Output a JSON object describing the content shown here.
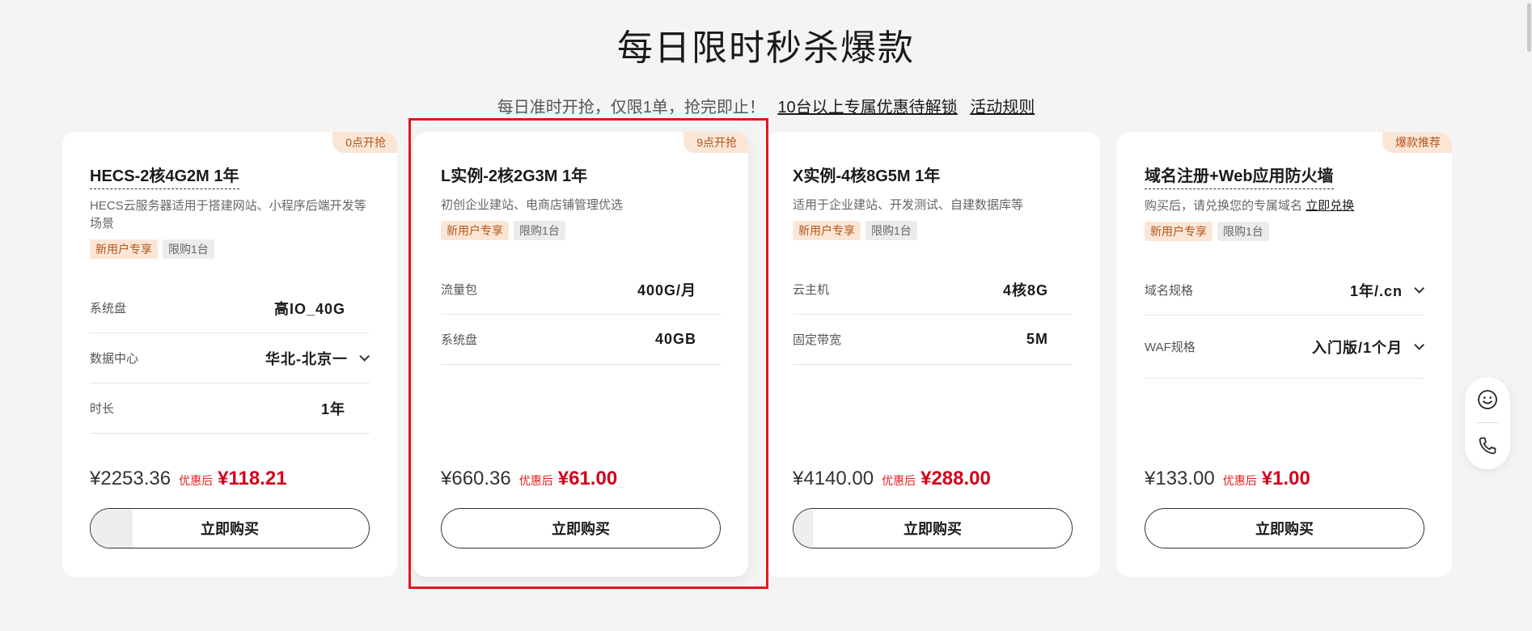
{
  "header": {
    "title": "每日限时秒杀爆款",
    "subtitle": "每日准时开抢，仅限1单，抢完即止！",
    "link_discount": "10台以上专属优惠待解锁",
    "link_rules": "活动规则"
  },
  "cards": [
    {
      "badge": "0点开抢",
      "title": "HECS-2核4G2M 1年",
      "desc": "HECS云服务器适用于搭建网站、小程序后端开发等场景",
      "tag_new": "新用户专享",
      "tag_limit": "限购1台",
      "specs": [
        {
          "label": "系统盘",
          "value": "高IO_40G"
        },
        {
          "label": "数据中心",
          "value": "华北-北京一"
        },
        {
          "label": "时长",
          "value": "1年"
        }
      ],
      "price_orig": "¥2253.36",
      "price_label": "优惠后",
      "price_final": "¥118.21",
      "buy_label": "立即购买",
      "buy_progress": 0.15
    },
    {
      "badge": "9点开抢",
      "title": "L实例-2核2G3M 1年",
      "desc": "初创企业建站、电商店铺管理优选",
      "tag_new": "新用户专享",
      "tag_limit": "限购1台",
      "specs": [
        {
          "label": "流量包",
          "value": "400G/月"
        },
        {
          "label": "系统盘",
          "value": "40GB"
        }
      ],
      "price_orig": "¥660.36",
      "price_label": "优惠后",
      "price_final": "¥61.00",
      "buy_label": "立即购买",
      "buy_progress": 0
    },
    {
      "title": "X实例-4核8G5M 1年",
      "desc": "适用于企业建站、开发测试、自建数据库等",
      "tag_new": "新用户专享",
      "tag_limit": "限购1台",
      "specs": [
        {
          "label": "云主机",
          "value": "4核8G"
        },
        {
          "label": "固定带宽",
          "value": "5M"
        }
      ],
      "price_orig": "¥4140.00",
      "price_label": "优惠后",
      "price_final": "¥288.00",
      "buy_label": "立即购买",
      "buy_progress": 0.07
    },
    {
      "badge": "爆款推荐",
      "title": "域名注册+Web应用防火墙",
      "desc": "购买后，请兑换您的专属域名",
      "desc_link": "立即兑换",
      "tag_new": "新用户专享",
      "tag_limit": "限购1台",
      "specs": [
        {
          "label": "域名规格",
          "value": "1年/.cn"
        },
        {
          "label": "WAF规格",
          "value": "入门版/1个月"
        }
      ],
      "price_orig": "¥133.00",
      "price_label": "优惠后",
      "price_final": "¥1.00",
      "buy_label": "立即购买",
      "buy_progress": 0
    }
  ],
  "float_bar": {
    "icons": [
      "smiley-icon",
      "phone-icon"
    ]
  }
}
